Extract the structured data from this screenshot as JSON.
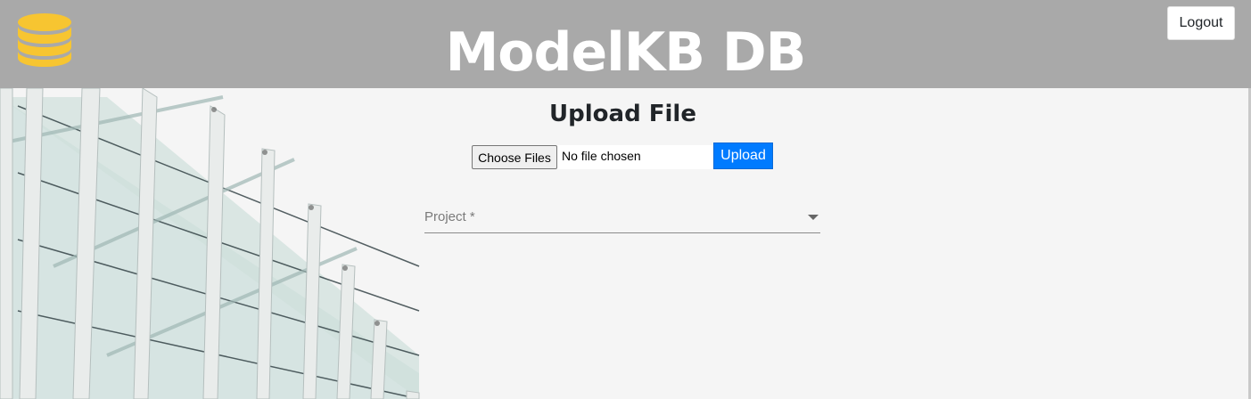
{
  "header": {
    "title": "ModelKB DB",
    "logo_icon": "database-icon",
    "logo_color": "#f7c531",
    "background": "#a9a9a9",
    "logout_label": "Logout"
  },
  "upload": {
    "title": "Upload File",
    "choose_label": "Choose Files",
    "file_status": "No file chosen",
    "upload_label": "Upload",
    "upload_color": "#007bff"
  },
  "project": {
    "label": "Project *",
    "arrow_icon": "dropdown-arrow-icon"
  }
}
